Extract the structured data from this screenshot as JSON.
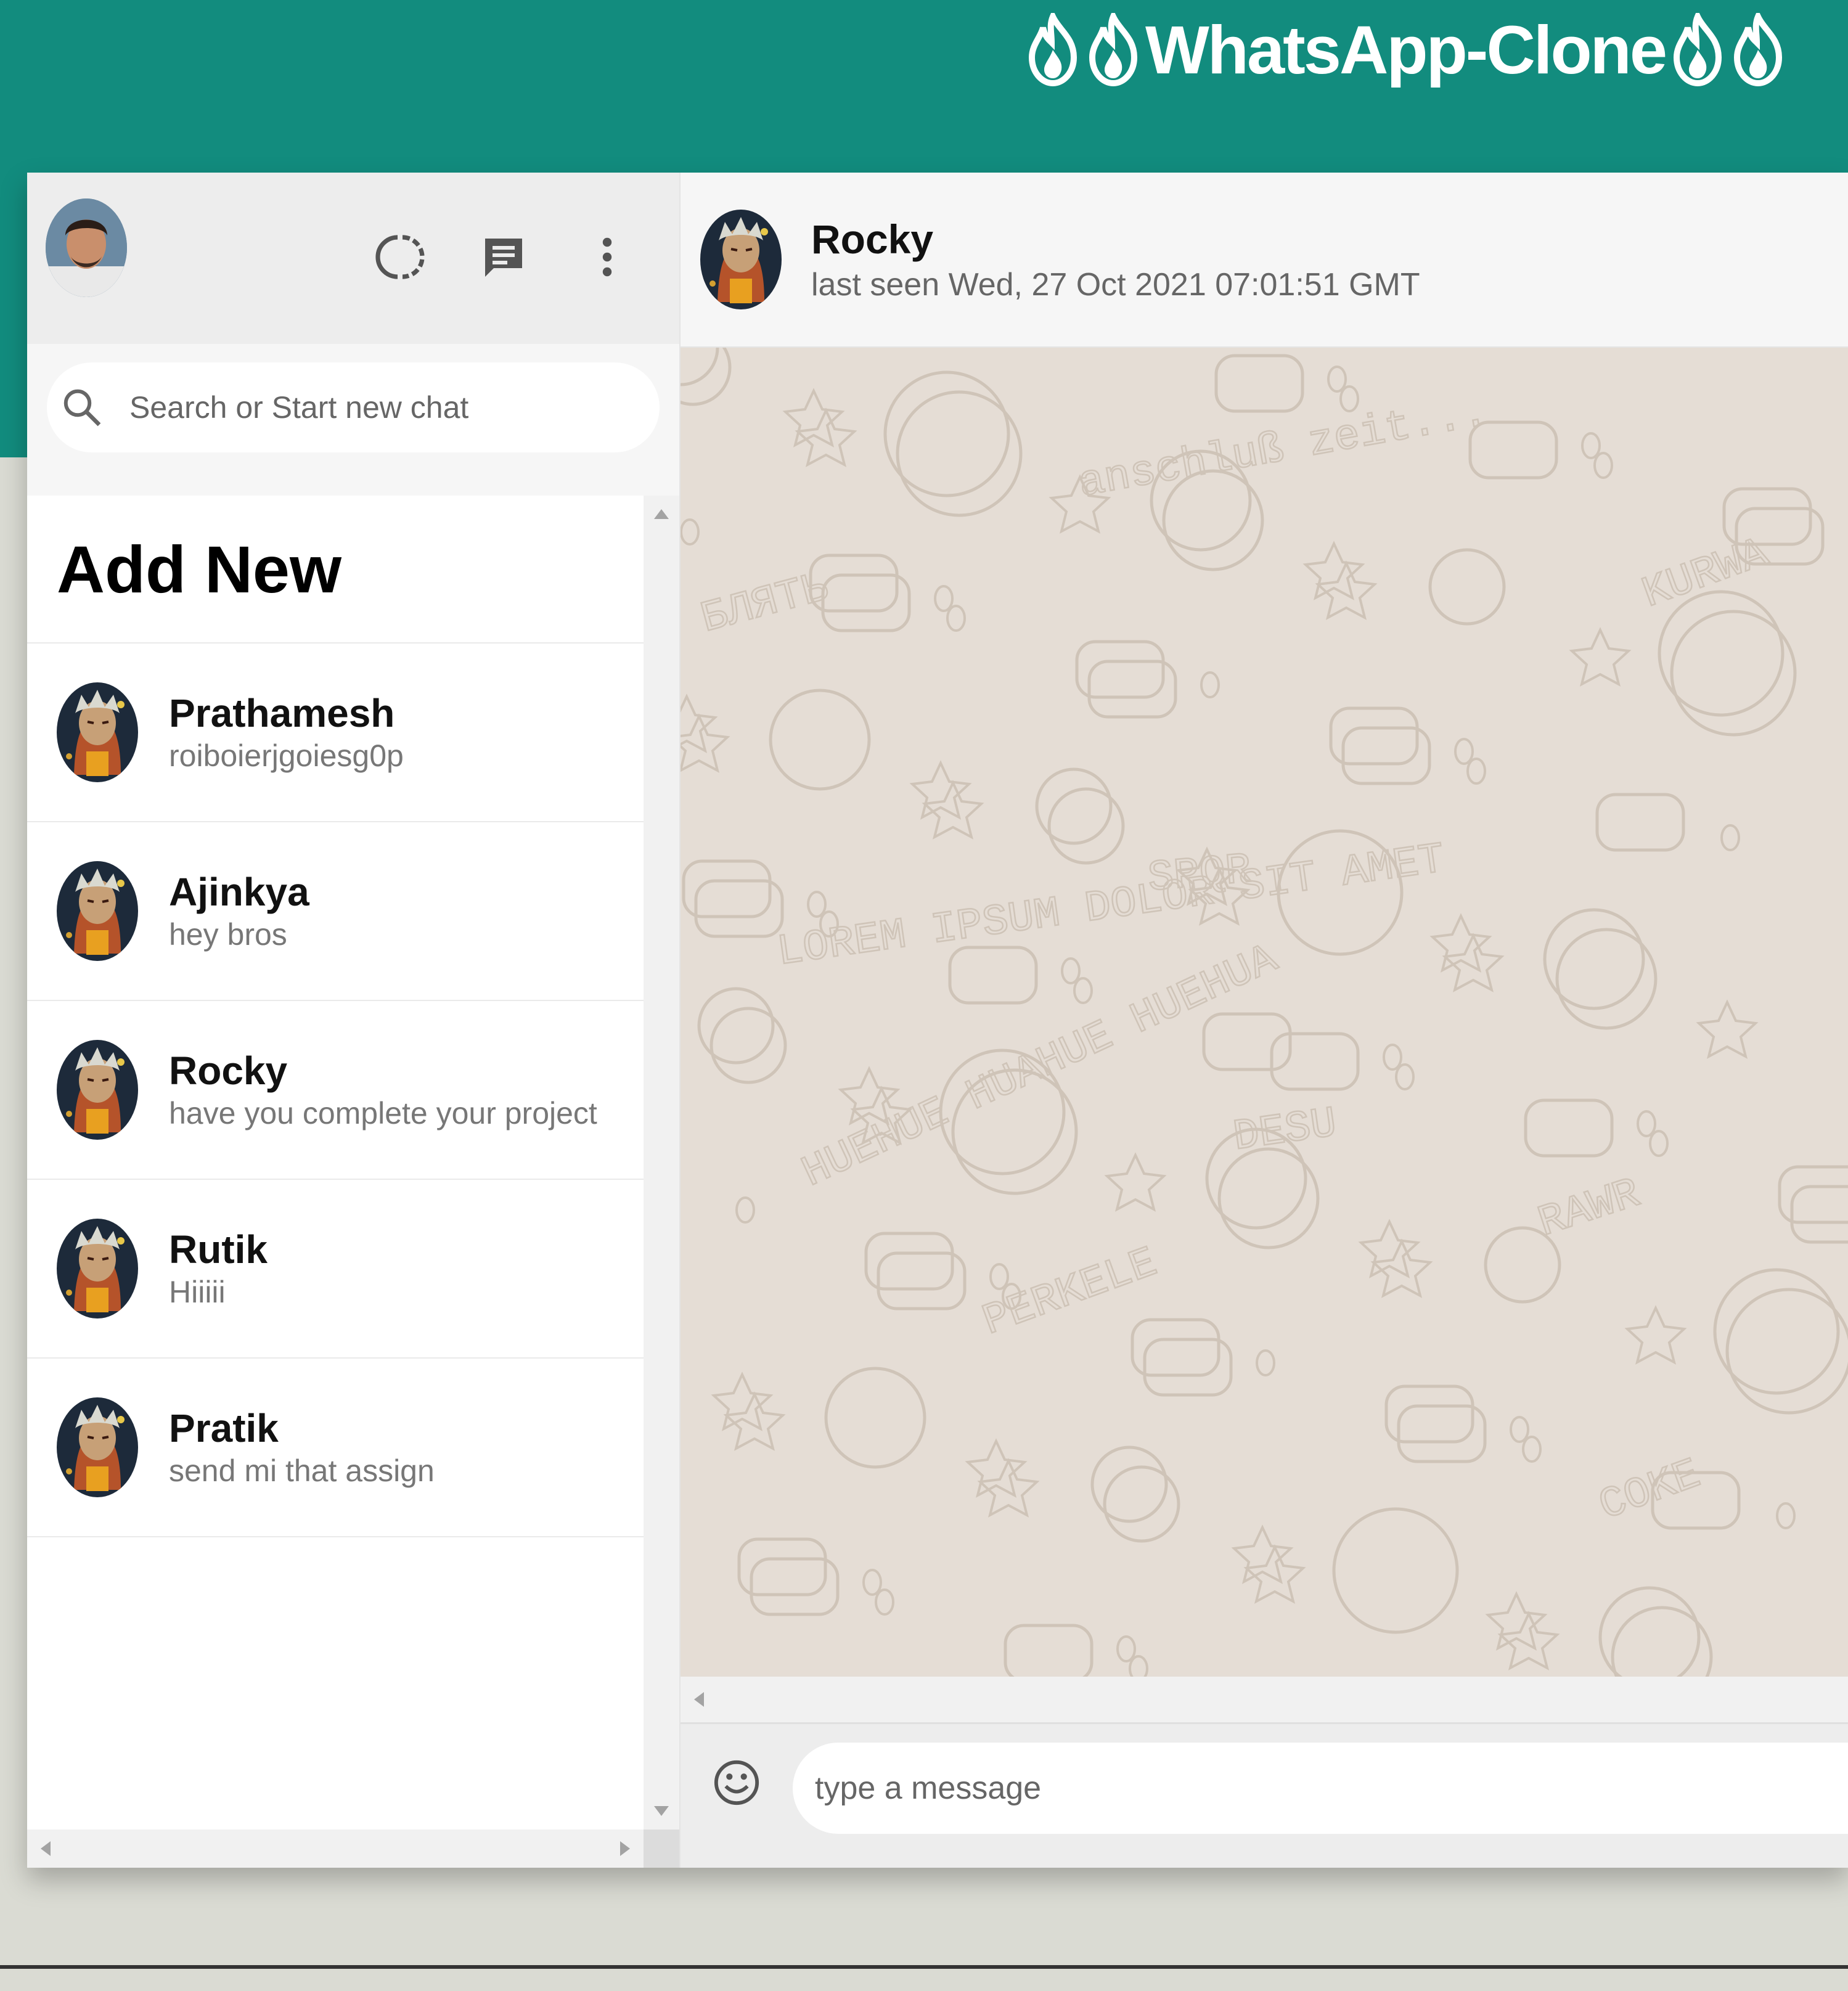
{
  "brand": {
    "title": "WhatsApp-Clone",
    "icon": "fire-icon",
    "color": "#128c7e"
  },
  "sidebar": {
    "header": {
      "avatar_icon": "user-avatar",
      "status_icon": "status-ring-icon",
      "chat_icon": "chat-icon",
      "menu_icon": "more-vert-icon"
    },
    "search": {
      "placeholder": "Search or Start new chat"
    },
    "add_new_label": "Add New",
    "chats": [
      {
        "name": "Prathamesh",
        "last_message": "roiboierjgoiesg0p"
      },
      {
        "name": "Ajinkya",
        "last_message": "hey bros"
      },
      {
        "name": "Rocky",
        "last_message": "have you complete your project"
      },
      {
        "name": "Rutik",
        "last_message": "Hiiiii"
      },
      {
        "name": "Pratik",
        "last_message": "send mi that assign"
      }
    ]
  },
  "chat": {
    "name": "Rocky",
    "status": "last seen Wed, 27 Oct 2021 07:01:51 GMT",
    "input_placeholder": "type a message",
    "emoji_icon": "emoji-icon",
    "wallpaper_color": "#e5ddd5",
    "doodle_words": [
      "anschluß zeit...",
      "KURWA",
      "БЛЯТЬ",
      "SPQR",
      "LOREM IPSUM DOLOR SIT AMET",
      "DESU",
      "HUEHUE HUAHUE HUEHUA",
      "RAWR",
      "PERKELE",
      "COKE"
    ]
  }
}
